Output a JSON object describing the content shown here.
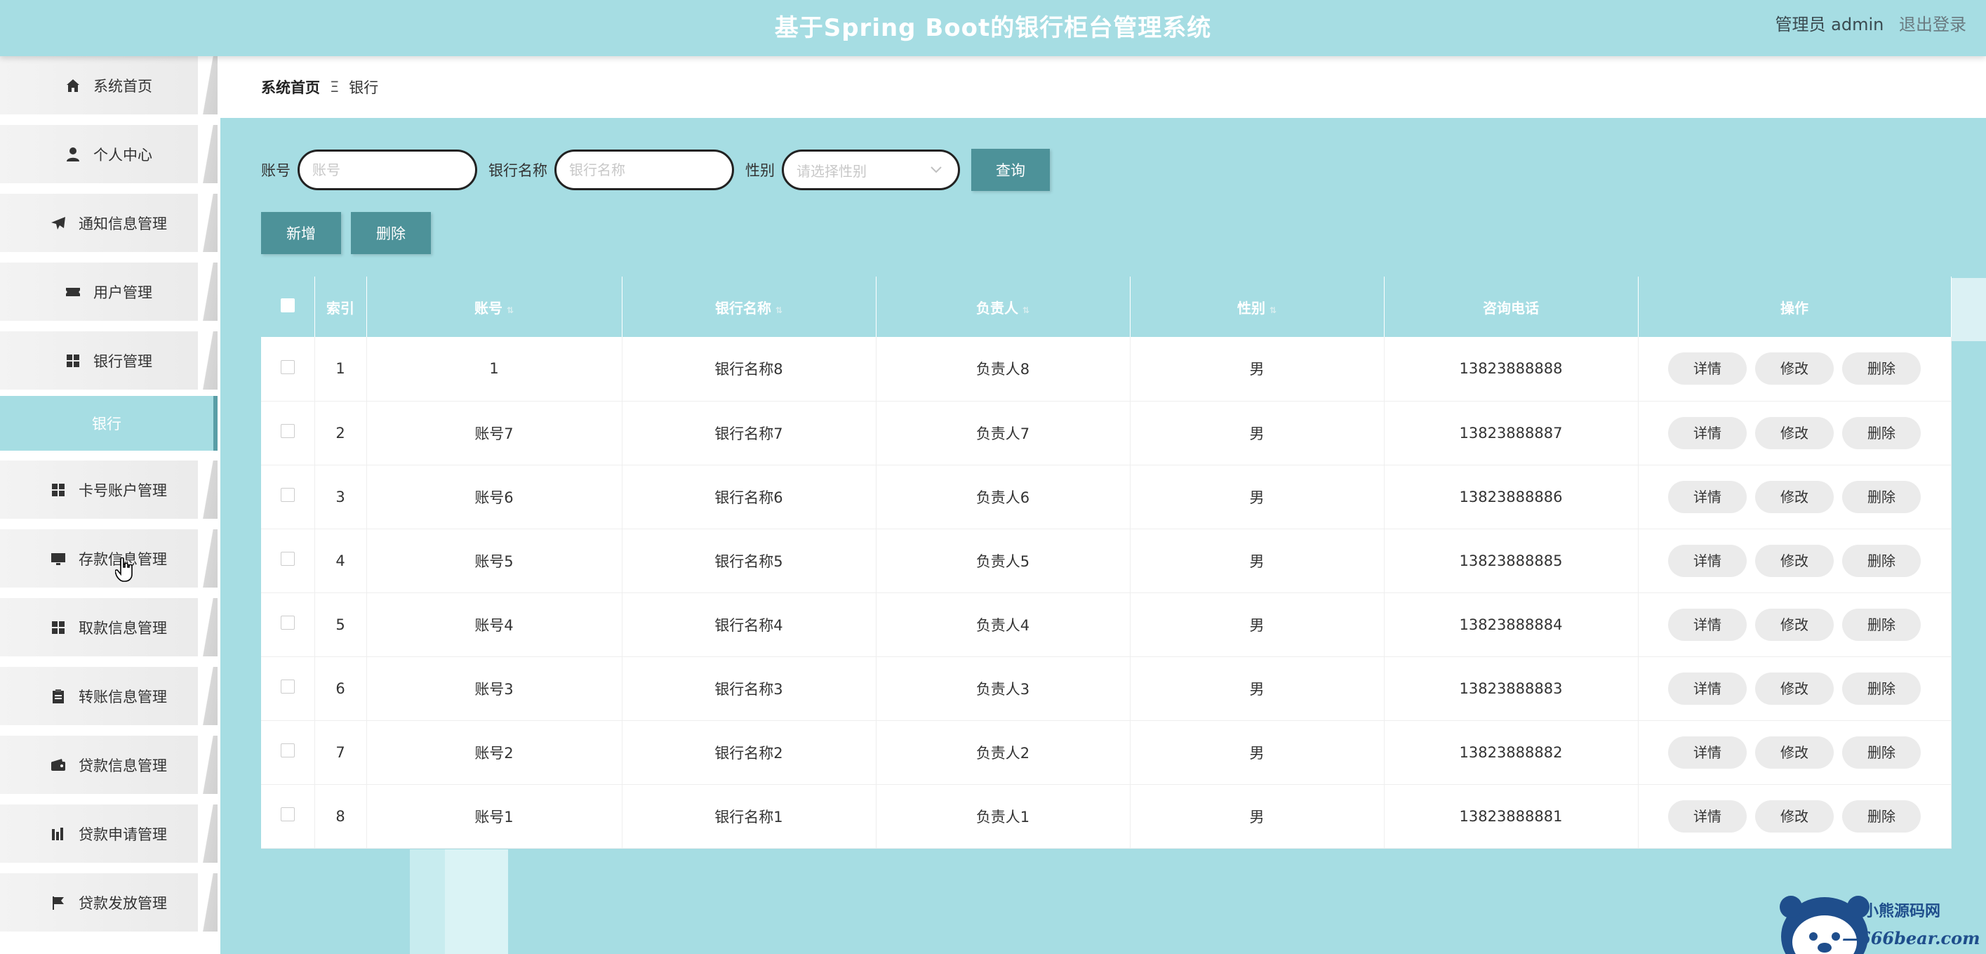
{
  "header": {
    "title": "基于Spring Boot的银行柜台管理系统",
    "user": "管理员 admin",
    "logout": "退出登录"
  },
  "sidebar": {
    "items": [
      {
        "label": "系统首页",
        "icon": "home-icon"
      },
      {
        "label": "个人中心",
        "icon": "user-icon"
      },
      {
        "label": "通知信息管理",
        "icon": "send-icon"
      },
      {
        "label": "用户管理",
        "icon": "ticket-icon"
      },
      {
        "label": "银行管理",
        "icon": "grid-icon"
      },
      {
        "label": "卡号账户管理",
        "icon": "grid-icon"
      },
      {
        "label": "存款信息管理",
        "icon": "monitor-icon"
      },
      {
        "label": "取款信息管理",
        "icon": "grid-icon"
      },
      {
        "label": "转账信息管理",
        "icon": "clipboard-icon"
      },
      {
        "label": "贷款信息管理",
        "icon": "wallet-icon"
      },
      {
        "label": "贷款申请管理",
        "icon": "bar-chart-icon"
      },
      {
        "label": "贷款发放管理",
        "icon": "flag-icon"
      }
    ],
    "active_sub": "银行"
  },
  "breadcrumb": {
    "home": "系统首页",
    "separator": "Ξ",
    "current": "银行"
  },
  "search": {
    "account_label": "账号",
    "account_placeholder": "账号",
    "bank_label": "银行名称",
    "bank_placeholder": "银行名称",
    "gender_label": "性别",
    "gender_placeholder": "请选择性别",
    "search_button": "查询"
  },
  "actions": {
    "add": "新增",
    "delete": "删除"
  },
  "table": {
    "headers": {
      "index": "索引",
      "account": "账号",
      "bank": "银行名称",
      "manager": "负责人",
      "gender": "性别",
      "phone": "咨询电话",
      "ops": "操作"
    },
    "row_buttons": {
      "detail": "详情",
      "edit": "修改",
      "delete": "删除"
    },
    "rows": [
      {
        "index": "1",
        "account": "1",
        "bank": "银行名称8",
        "manager": "负责人8",
        "gender": "男",
        "phone": "13823888888"
      },
      {
        "index": "2",
        "account": "账号7",
        "bank": "银行名称7",
        "manager": "负责人7",
        "gender": "男",
        "phone": "13823888887"
      },
      {
        "index": "3",
        "account": "账号6",
        "bank": "银行名称6",
        "manager": "负责人6",
        "gender": "男",
        "phone": "13823888886"
      },
      {
        "index": "4",
        "account": "账号5",
        "bank": "银行名称5",
        "manager": "负责人5",
        "gender": "男",
        "phone": "13823888885"
      },
      {
        "index": "5",
        "account": "账号4",
        "bank": "银行名称4",
        "manager": "负责人4",
        "gender": "男",
        "phone": "13823888884"
      },
      {
        "index": "6",
        "account": "账号3",
        "bank": "银行名称3",
        "manager": "负责人3",
        "gender": "男",
        "phone": "13823888883"
      },
      {
        "index": "7",
        "account": "账号2",
        "bank": "银行名称2",
        "manager": "负责人2",
        "gender": "男",
        "phone": "13823888882"
      },
      {
        "index": "8",
        "account": "账号1",
        "bank": "银行名称1",
        "manager": "负责人1",
        "gender": "男",
        "phone": "13823888881"
      }
    ]
  },
  "watermark": {
    "line1": "小熊源码网",
    "line2": "—666bear.com—"
  },
  "colors": {
    "accent": "#a6dde3",
    "button": "#4d9299"
  }
}
